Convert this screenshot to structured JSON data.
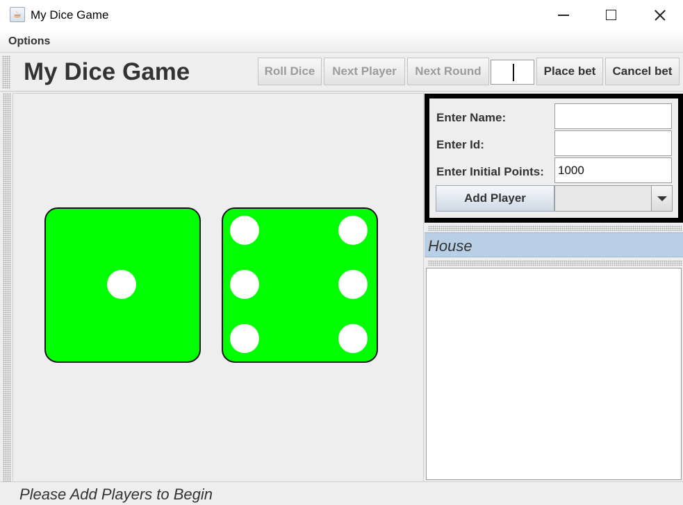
{
  "window": {
    "title": "My Dice Game",
    "icon": "java-cup-icon"
  },
  "menu": {
    "options_label": "Options"
  },
  "toolbar": {
    "heading": "My Dice Game",
    "roll_dice": "Roll Dice",
    "next_player": "Next Player",
    "next_round": "Next Round",
    "bet_value": "",
    "place_bet": "Place bet",
    "cancel_bet": "Cancel bet"
  },
  "dice": {
    "color": "#00ff00",
    "pip_color": "#ffffff",
    "values": [
      1,
      6
    ]
  },
  "player_form": {
    "name_label": "Enter Name:",
    "name_value": "",
    "id_label": "Enter Id:",
    "id_value": "",
    "points_label": "Enter Initial Points:",
    "points_value": "1000",
    "add_player": "Add Player",
    "player_select_value": ""
  },
  "house": {
    "title": "House",
    "accent": "#b8cfe5"
  },
  "status": {
    "text": "Please Add Players to Begin"
  }
}
